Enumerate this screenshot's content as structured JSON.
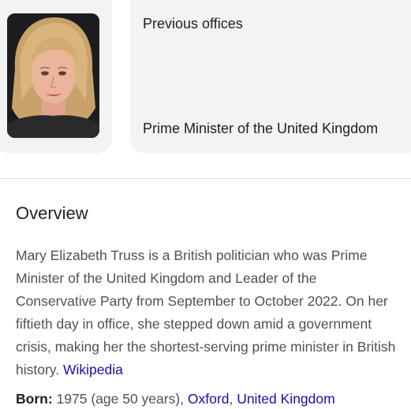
{
  "carousel": {
    "portrait_alt": "Portrait photo",
    "heading": "Previous offices",
    "office": "Prime Minister of the United Kingdom"
  },
  "overview": {
    "title": "Overview",
    "description": "Mary Elizabeth Truss is a British politician who was Prime Minister of the United Kingdom and Leader of the Conservative Party from September to October 2022. On her fiftieth day in office, she stepped down amid a government crisis, making her the shortest-serving prime minister in British history.",
    "source_link": "Wikipedia"
  },
  "born": {
    "label": "Born:",
    "value": "1975 (age 50 years),",
    "place_city": "Oxford",
    "place_separator": ",",
    "place_country": "United Kingdom"
  },
  "colors": {
    "link": "#1a0dab",
    "card_bg": "#f1f3f4",
    "text_primary": "#202124",
    "text_secondary": "#4d5156"
  }
}
